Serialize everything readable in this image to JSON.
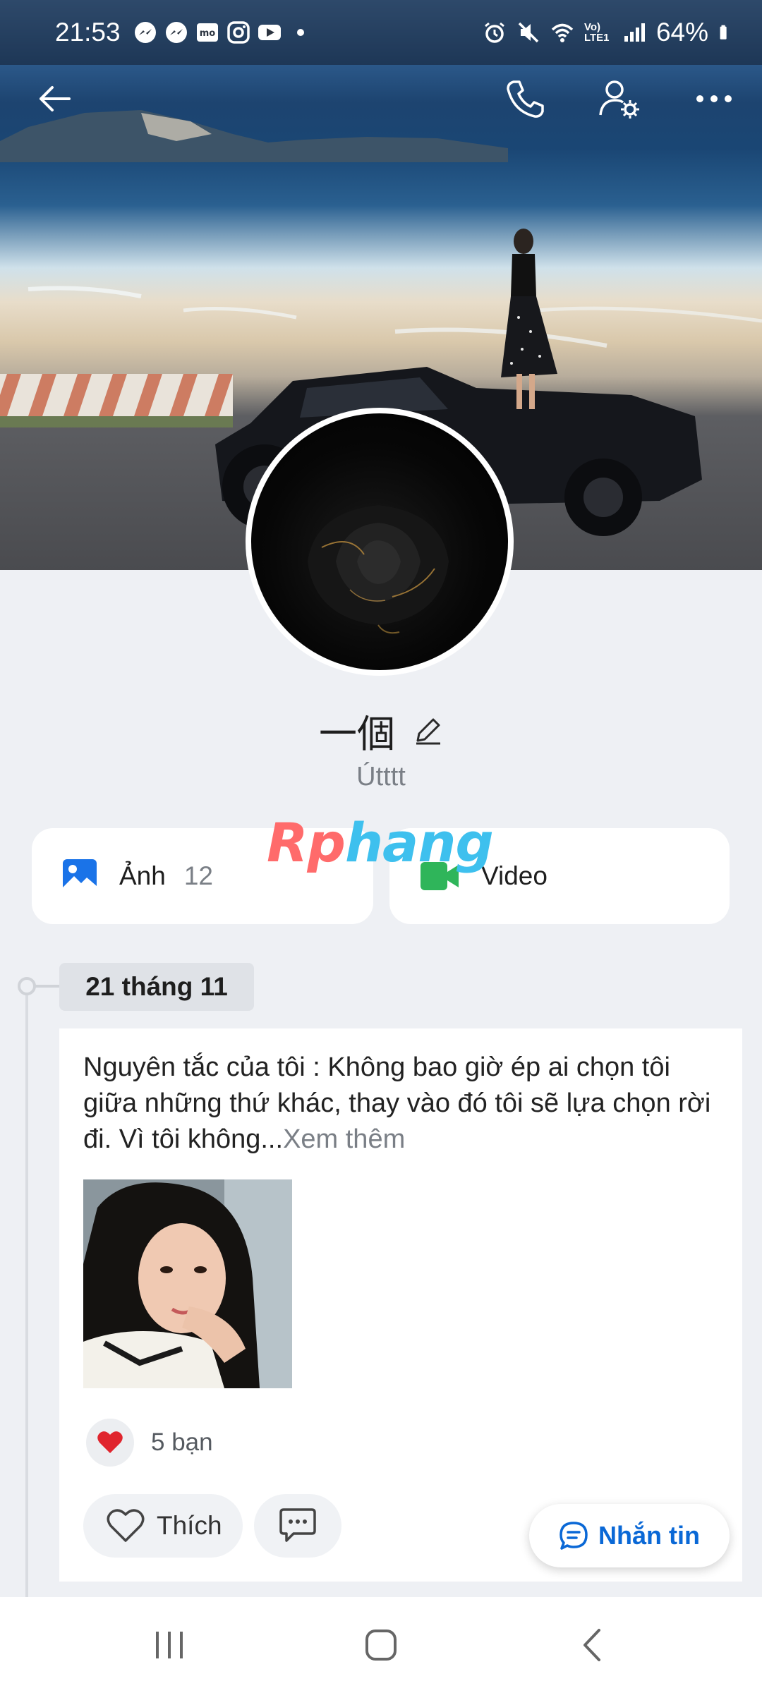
{
  "status_bar": {
    "time": "21:53",
    "battery": "64%",
    "network": "Vo) LTE1",
    "notification_icons": [
      "messenger-icon",
      "messenger-icon",
      "momo-icon",
      "instagram-icon",
      "youtube-icon",
      "dot-icon"
    ],
    "system_icons": [
      "alarm-icon",
      "mute-icon",
      "wifi-icon",
      "signal-icon",
      "battery-icon"
    ]
  },
  "top_bar": {
    "icons": [
      "back-arrow-icon",
      "phone-icon",
      "user-settings-icon",
      "more-icon"
    ]
  },
  "profile": {
    "name": "一個",
    "subtitle": "Útttt"
  },
  "watermark": {
    "part1": "Rp",
    "part2": "hang"
  },
  "media": {
    "photos_label": "Ảnh",
    "photos_count": "12",
    "video_label": "Video"
  },
  "timeline": {
    "date": "21 tháng 11"
  },
  "post": {
    "text": "Nguyên tắc của tôi : Không bao giờ ép ai chọn tôi giữa những thứ khác, thay vào đó tôi sẽ lựa chọn rời đi. Vì tôi không...",
    "see_more": "Xem thêm",
    "reaction_count": "5 bạn",
    "like_label": "Thích"
  },
  "message_button": {
    "label": "Nhắn tin"
  },
  "colors": {
    "accent": "#0a68d6",
    "video_green": "#2fb55a",
    "photo_blue": "#1a73e8",
    "heart_red": "#e0252e",
    "background": "#eef0f4"
  }
}
